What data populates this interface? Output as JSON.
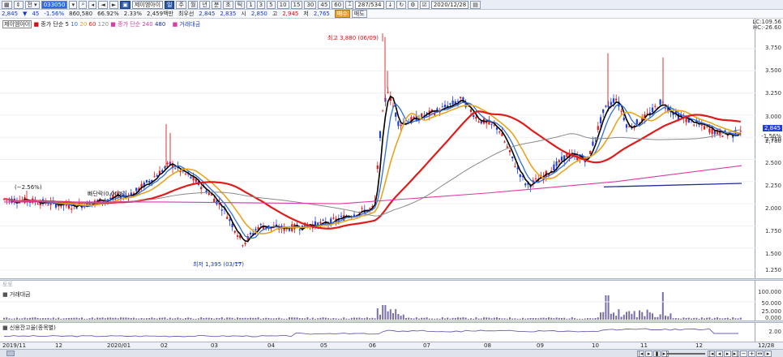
{
  "toolbar": {
    "code": "033050",
    "stock": "제이엠아이",
    "timeframes": [
      "주",
      "월",
      "년",
      "분",
      "초",
      "틱"
    ],
    "intervals": [
      "1",
      "3",
      "5",
      "10",
      "15",
      "30",
      "45",
      "60"
    ],
    "count": "287/534",
    "date": "2020/12/28"
  },
  "quote": {
    "price": "2,845",
    "change": "45",
    "change_pct": "-1.56%",
    "volume": "860,580",
    "vol_pct": "66.92%",
    "turnover": "2.33%",
    "amount": "2,459백만",
    "prev_label": "최우선",
    "prev": "2,845",
    "bid": "2,835",
    "open_label": "시",
    "open": "2,850",
    "high_label": "고",
    "high": "2,945",
    "low_label": "저",
    "low": "2,765",
    "buy_label": "매수",
    "sell_label": "매도"
  },
  "price_panel": {
    "title_stock": "제이엠아이",
    "ma_label": "종가 단순 5",
    "ma_periods": [
      "10",
      "20",
      "60",
      "120"
    ],
    "ma2_label": "종가 단순 240",
    "ma2_periods": [
      "480"
    ],
    "vol_label": "거래대금",
    "lc": "LC:109.56",
    "hc": "HC:-26.60",
    "annot_high": "최고 3,880 (06/09)",
    "annot_low": "최저 1,395 (03/17)",
    "annot_left": "(−2.56%)",
    "annot_mid": "빠단락(0.00%)",
    "current_price": "2,845",
    "current_pct": "-1.56%",
    "current_extra": "2,780",
    "y_labels": [
      "3.750",
      "3.500",
      "3.250",
      "3.000",
      "2.750",
      "2.500",
      "2.250",
      "2.000",
      "1.750",
      "1.500",
      "1.250"
    ]
  },
  "volume_panel": {
    "top_label": "토토",
    "title": "거래대금",
    "y_labels": [
      "100.000",
      "50.000",
      "25.000",
      "0.000"
    ]
  },
  "credit_panel": {
    "title": "신용잔고율(종목별)",
    "y_labels": [
      "2.00"
    ]
  },
  "x_labels": [
    "2019/11",
    "12",
    "2020/01",
    "02",
    "03",
    "04",
    "05",
    "06",
    "07",
    "08",
    "09",
    "10",
    "11",
    "12",
    "12/28"
  ],
  "colors": {
    "up": "#e01b1b",
    "down": "#1e3fd8",
    "ma5": "#000000",
    "ma10": "#2f6ed6",
    "ma20": "#e8a51c",
    "ma60": "#e01b1b",
    "ma120": "#8a8a8a",
    "ma240": "#d73ca8",
    "ma480": "#1c2c8f"
  }
}
